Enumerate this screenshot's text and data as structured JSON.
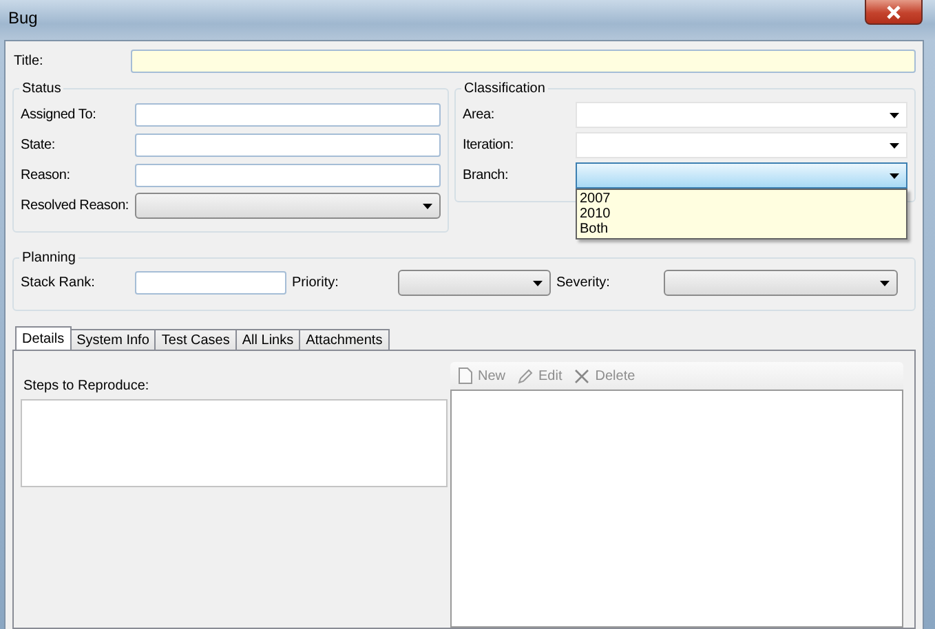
{
  "window": {
    "title": "Bug"
  },
  "title_field": {
    "label": "Title:"
  },
  "status": {
    "heading": "Status",
    "fields": [
      {
        "label": "Assigned To:",
        "kind": "text"
      },
      {
        "label": "State:",
        "kind": "text"
      },
      {
        "label": "Reason:",
        "kind": "text"
      },
      {
        "label": "Resolved Reason:",
        "kind": "dropdown"
      }
    ]
  },
  "classification": {
    "heading": "Classification",
    "fields": [
      {
        "label": "Area:",
        "kind": "combo",
        "expanded": false
      },
      {
        "label": "Iteration:",
        "kind": "combo",
        "expanded": false
      },
      {
        "label": "Branch:",
        "kind": "combo",
        "expanded": true,
        "options": [
          "2007",
          "2010",
          "Both"
        ]
      }
    ]
  },
  "planning": {
    "heading": "Planning",
    "fields": [
      {
        "label": "Stack Rank:",
        "kind": "text"
      },
      {
        "label": "Priority:",
        "kind": "dropdown"
      },
      {
        "label": "Severity:",
        "kind": "dropdown"
      }
    ]
  },
  "tabs": [
    {
      "label": "Details",
      "selected": true
    },
    {
      "label": "System Info",
      "selected": false
    },
    {
      "label": "Test Cases",
      "selected": false
    },
    {
      "label": "All Links",
      "selected": false
    },
    {
      "label": "Attachments",
      "selected": false
    }
  ],
  "details": {
    "steps_label": "Steps to Reproduce:",
    "toolbar": [
      {
        "label": "New",
        "kind": "new",
        "disabled": true
      },
      {
        "label": "Edit",
        "kind": "edit",
        "disabled": true
      },
      {
        "label": "Delete",
        "kind": "delete",
        "disabled": true
      }
    ]
  }
}
